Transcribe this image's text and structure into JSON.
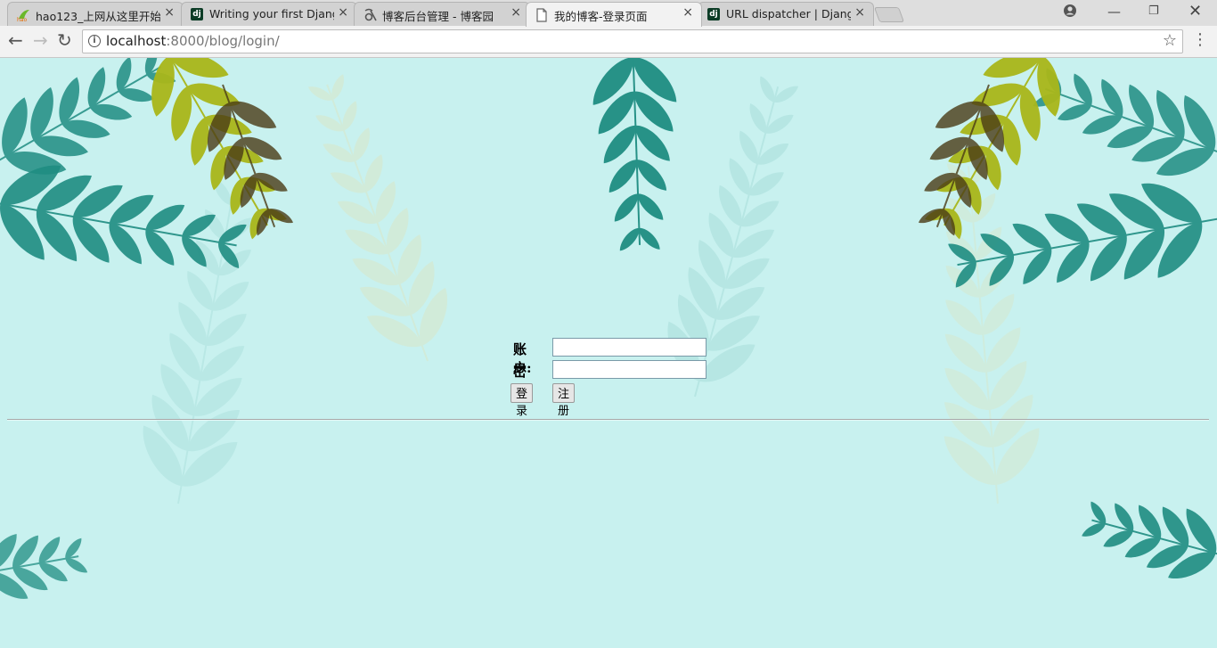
{
  "browser": {
    "tabs": [
      {
        "title": "hao123_上网从这里开始",
        "icon": "hao123-icon",
        "active": false
      },
      {
        "title": "Writing your first Djang",
        "icon": "django-icon",
        "active": false
      },
      {
        "title": "博客后台管理 - 博客园",
        "icon": "cnblogs-icon",
        "active": false
      },
      {
        "title": "我的博客-登录页面",
        "icon": "page-icon",
        "active": true
      },
      {
        "title": "URL dispatcher | Djang",
        "icon": "django-icon",
        "active": false
      }
    ],
    "url_host": "localhost",
    "url_rest": ":8000/blog/login/",
    "accent": "#4a4a4a"
  },
  "login": {
    "account_label": "账户:",
    "password_label": "密码:",
    "account_value": "",
    "password_value": "",
    "login_button": "登录",
    "register_button": "注册"
  },
  "colors": {
    "page_background": "#c8f1ef",
    "leaf_teal": "#1f8d82",
    "leaf_olive": "#a9b71a",
    "leaf_dark": "#4a3b16"
  }
}
